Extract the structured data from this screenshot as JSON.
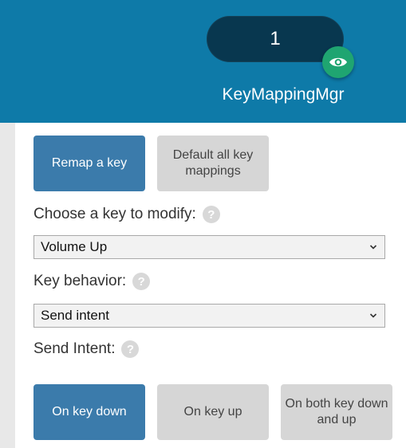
{
  "header": {
    "counter": "1",
    "app_name": "KeyMappingMgr",
    "badge_icon": "eye-icon",
    "colors": {
      "header_bg": "#0e7aa8",
      "pill_bg": "#08374f",
      "badge_bg": "#1fa571"
    }
  },
  "actions": {
    "remap_label": "Remap a key",
    "default_label": "Default all key mappings"
  },
  "key_select": {
    "label": "Choose a key to modify:",
    "value": "Volume Up"
  },
  "behavior_select": {
    "label": "Key behavior:",
    "value": "Send intent"
  },
  "send_intent": {
    "label": "Send Intent:",
    "options": [
      "On key down",
      "On key up",
      "On both key down and up"
    ],
    "selected": "On key down"
  },
  "colors": {
    "primary": "#3b7bab",
    "secondary": "#d6d6d6"
  }
}
